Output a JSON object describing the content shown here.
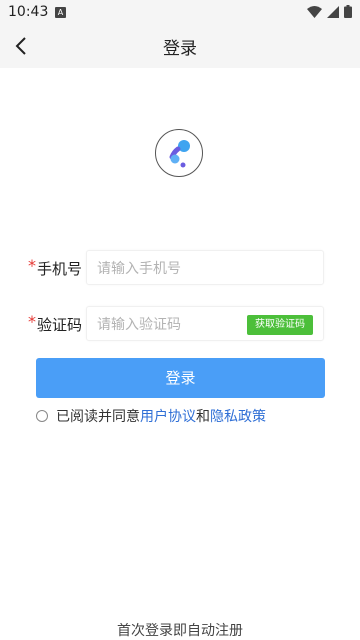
{
  "status": {
    "time": "10:43",
    "notification_icon": "A"
  },
  "header": {
    "title": "登录"
  },
  "form": {
    "phone": {
      "required_mark": "*",
      "label": "手机号",
      "placeholder": "请输入手机号",
      "value": ""
    },
    "code": {
      "required_mark": "*",
      "label": "验证码",
      "placeholder": "请输入验证码",
      "value": "",
      "get_code_label": "获取验证码"
    },
    "login_label": "登录"
  },
  "agreement": {
    "prefix": "已阅读并同意",
    "user_agreement": "用户协议",
    "and": "和",
    "privacy_policy": "隐私政策",
    "checked": false
  },
  "footer_text": "首次登录即自动注册",
  "colors": {
    "primary": "#4a9ef7",
    "code_button": "#4cbf3a",
    "link": "#2f6fd6",
    "required": "#e53935"
  }
}
